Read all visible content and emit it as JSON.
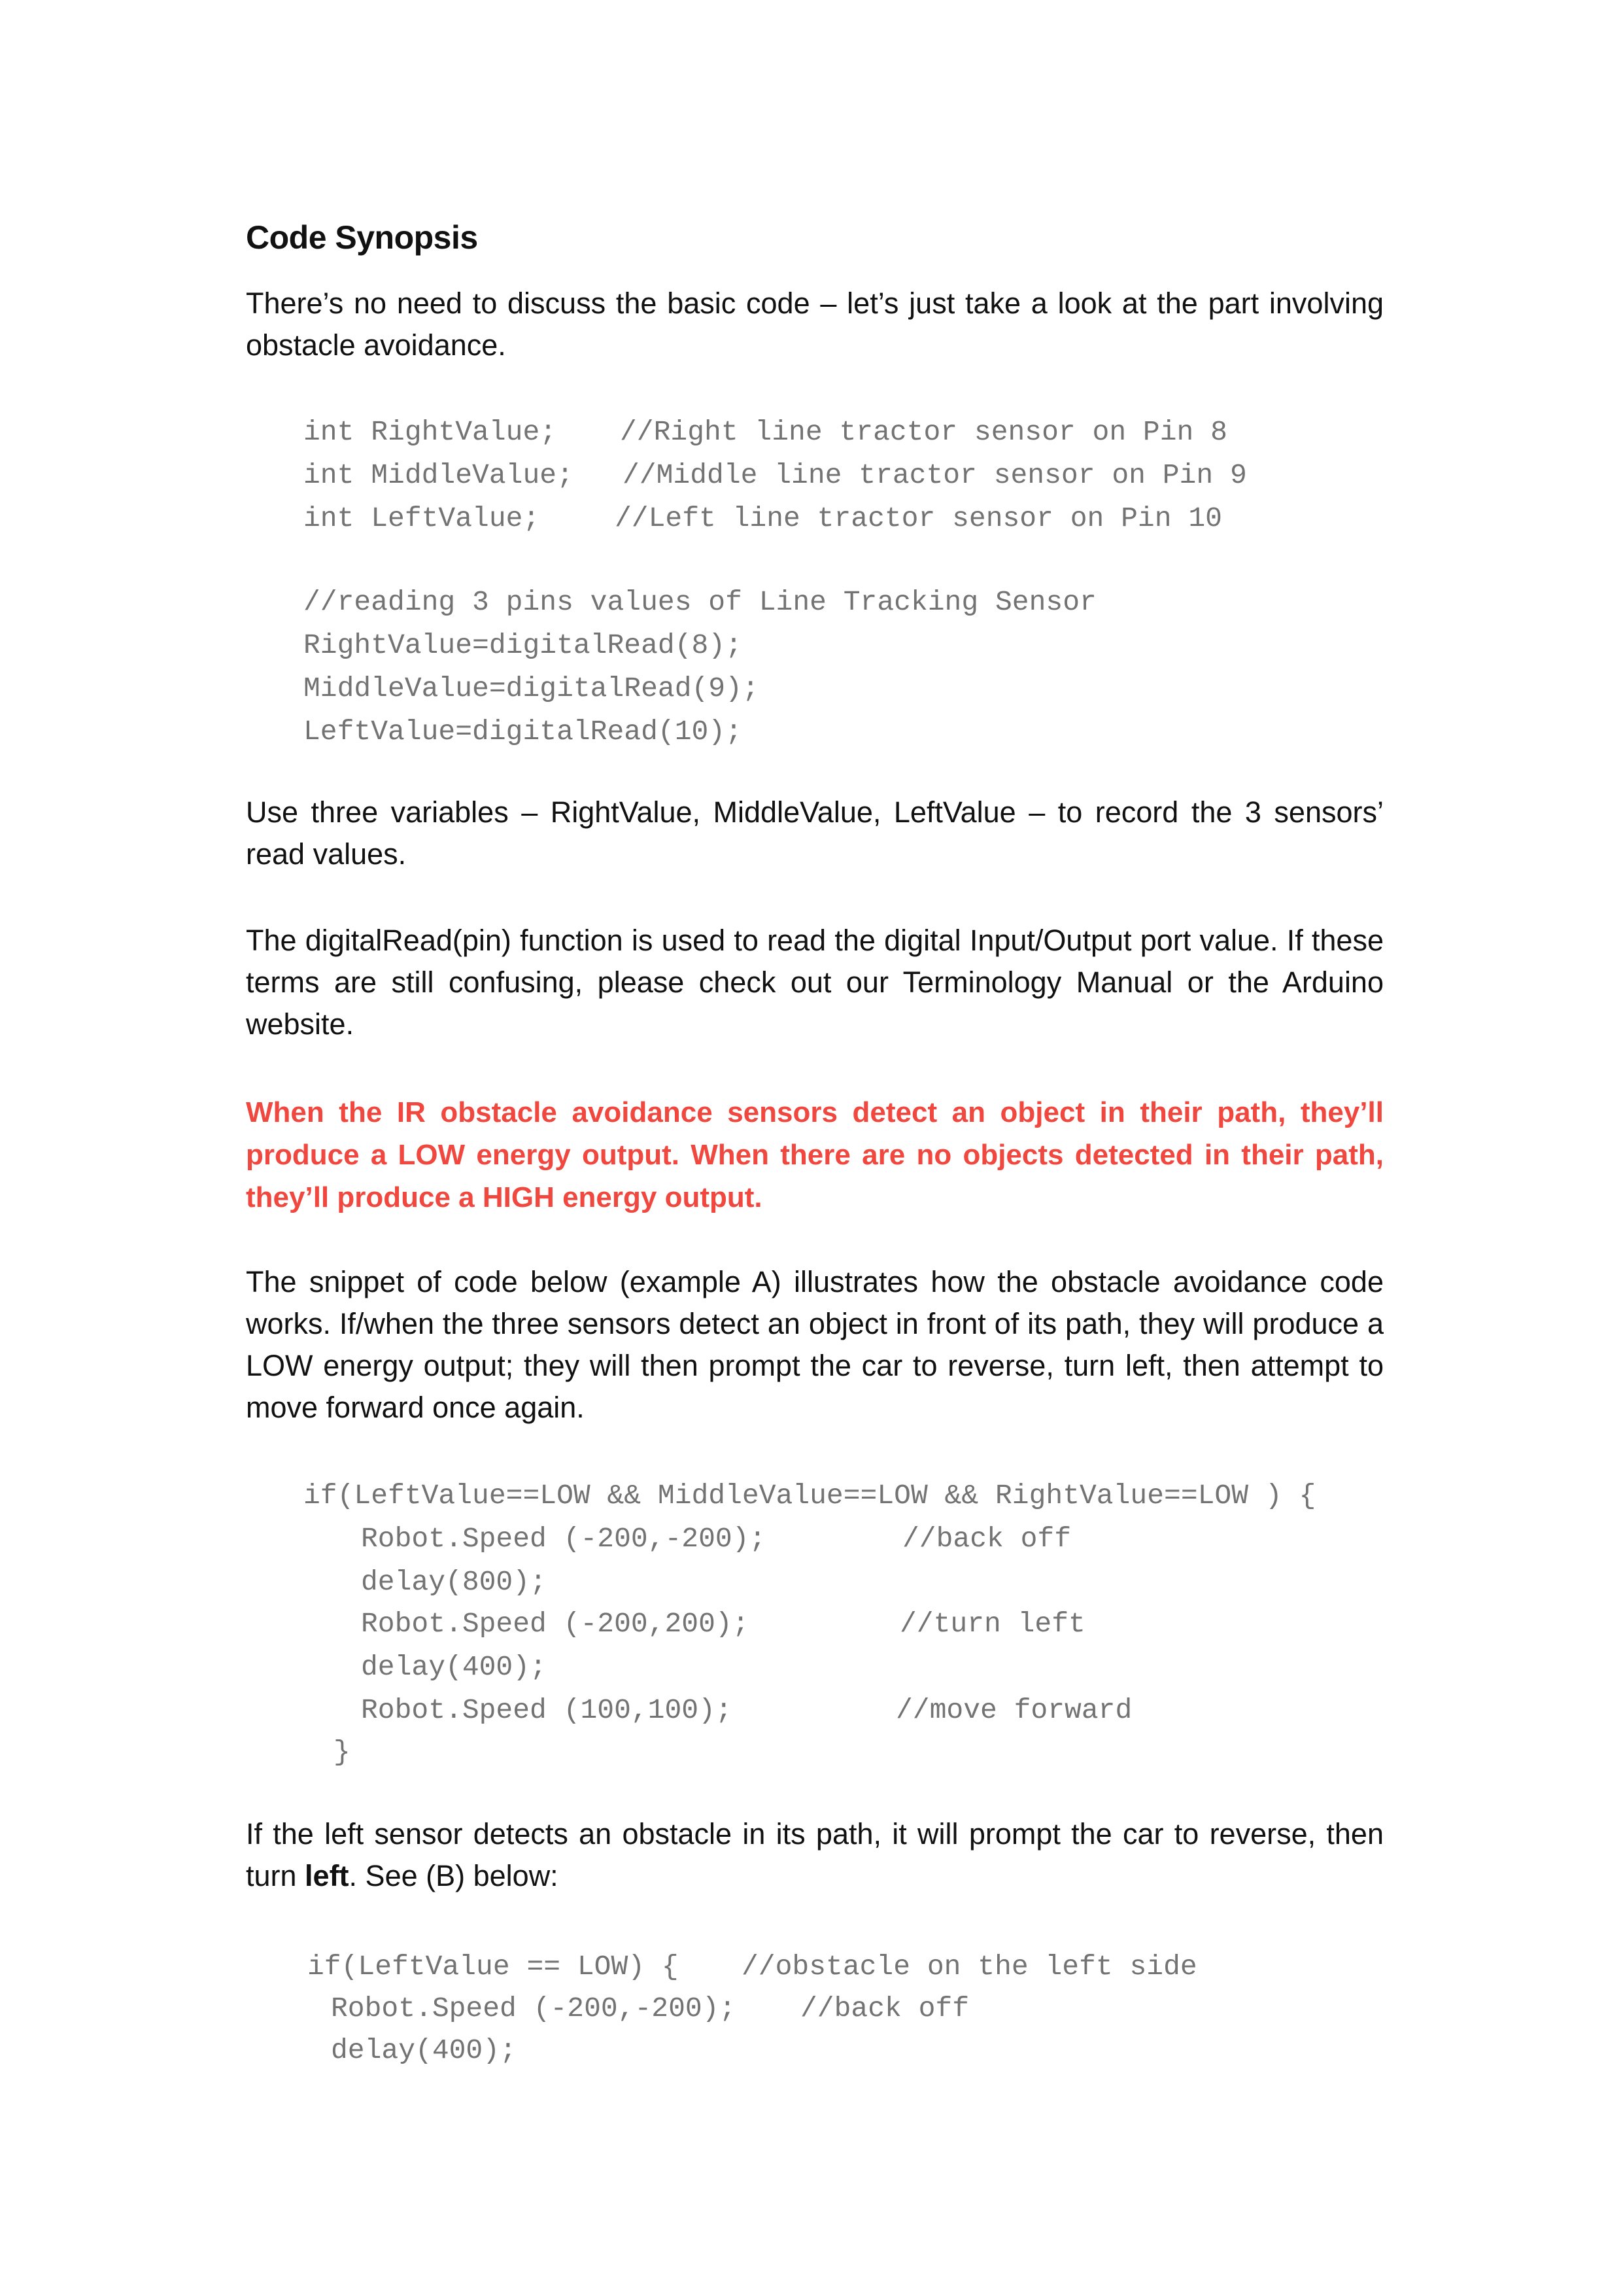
{
  "heading": "Code Synopsis",
  "paragraphs": {
    "intro": "There’s no need to discuss the basic code – let’s just take a look at the part involving obstacle avoidance.",
    "variables": "Use three variables – RightValue, MiddleValue, LeftValue – to record the 3 sensors’ read values.",
    "digitalread": "The digitalRead(pin) function is used to read the digital Input/Output port value. If these terms are still confusing, please check out our Terminology Manual or the Arduino website.",
    "warning": "When the IR obstacle avoidance sensors detect an object in their path, they’ll produce a LOW energy output. When there are no objects detected in their path, they’ll produce a HIGH energy output.",
    "example_a": "The snippet of code below (example A) illustrates how the obstacle avoidance code works. If/when the three sensors detect an object in front of its path, they will produce a LOW energy output; they will then prompt the car to reverse, turn left, then attempt to move forward once again.",
    "left_sensor_pre": "If the left sensor detects an obstacle in its path, it will prompt the car to reverse, then turn ",
    "left_sensor_bold": "left",
    "left_sensor_post": ". See (B) below:"
  },
  "code_declarations": [
    {
      "code": "int RightValue;",
      "comment": "//Right line tractor sensor on Pin 8"
    },
    {
      "code": "int MiddleValue;",
      "comment": "//Middle line tractor sensor on Pin 9"
    },
    {
      "code": "int LeftValue;",
      "comment": "//Left line tractor sensor on Pin 10"
    }
  ],
  "code_reading": [
    "//reading 3 pins values of Line Tracking Sensor",
    "RightValue=digitalRead(8);",
    "MiddleValue=digitalRead(9);",
    "LeftValue=digitalRead(10);"
  ],
  "code_example_a": {
    "condition": "if(LeftValue==LOW && MiddleValue==LOW && RightValue==LOW ) {",
    "lines": [
      {
        "code": "Robot.Speed (-200,-200);",
        "comment": "//back off"
      },
      {
        "code": "delay(800);",
        "comment": ""
      },
      {
        "code": "Robot.Speed (-200,200);",
        "comment": "//turn left"
      },
      {
        "code": "delay(400);",
        "comment": ""
      },
      {
        "code": "Robot.Speed (100,100);",
        "comment": "//move forward"
      }
    ],
    "close": "}"
  },
  "code_example_b": {
    "condition": "if(LeftValue == LOW) {",
    "condition_comment": "//obstacle on the left side",
    "lines": [
      {
        "code": "Robot.Speed (-200,-200);",
        "comment": "//back off"
      },
      {
        "code": "delay(400);",
        "comment": ""
      }
    ]
  }
}
